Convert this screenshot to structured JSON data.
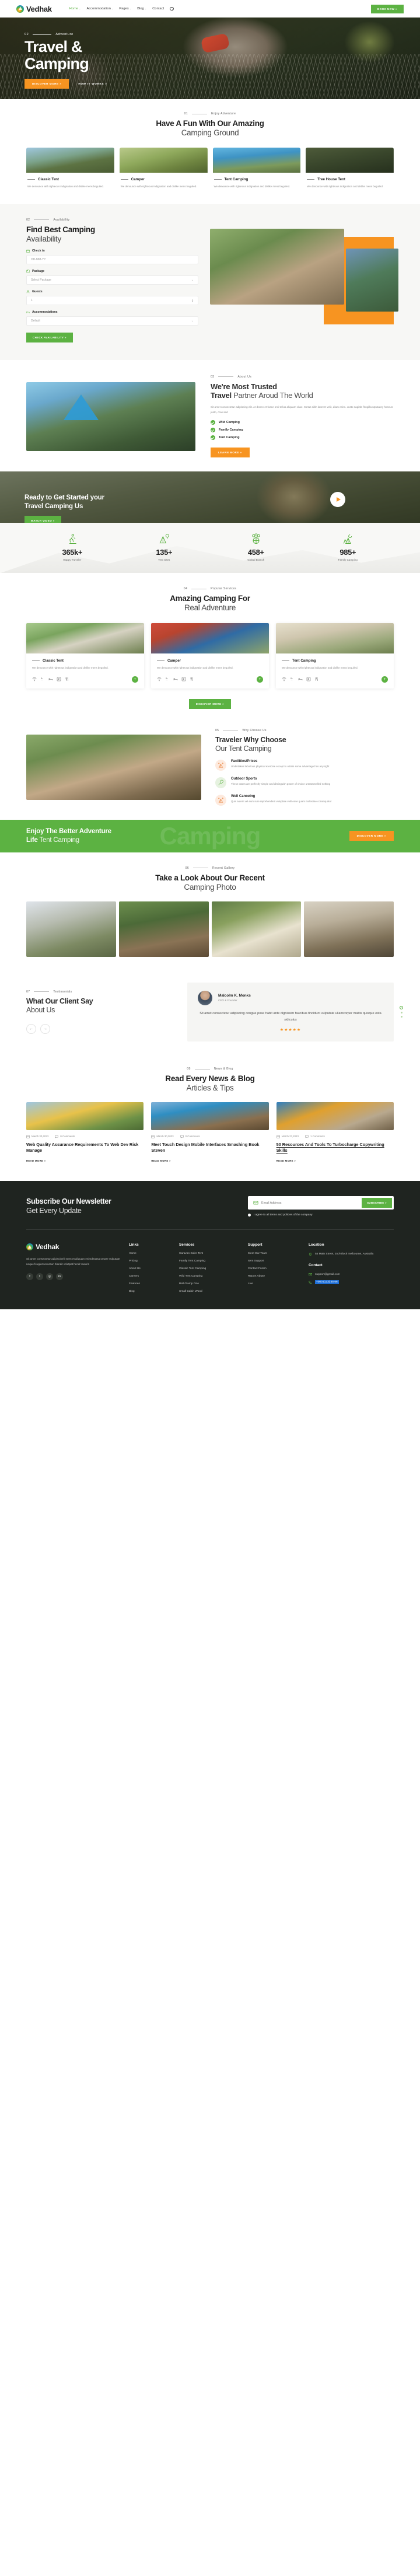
{
  "brand": {
    "name": "Vedhak"
  },
  "header": {
    "nav": [
      {
        "label": "Home",
        "caret": "⌄",
        "active": true
      },
      {
        "label": "Accommodation",
        "caret": "⌄",
        "active": false
      },
      {
        "label": "Pages",
        "caret": "⌄",
        "active": false
      },
      {
        "label": "Blog",
        "caret": "⌄",
        "active": false
      },
      {
        "label": "Contact",
        "caret": "",
        "active": false
      }
    ],
    "search_icon": "search-icon",
    "book_now": "BOOK NOW »"
  },
  "hero": {
    "number": "02",
    "eyebrow": "Adventure",
    "title_line1": "Travel &",
    "title_line2": "Camping",
    "primary_btn": "DISCOVER MORE »",
    "secondary_btn": "HOW IT WORKS »"
  },
  "ground": {
    "number": "01",
    "eyebrow": "Enjoy Adventure",
    "title": "Have A Fun With Our Amazing",
    "subtitle": "Camping Ground",
    "cards": [
      {
        "title": "Classic Tent",
        "text": "We denounce with righteous indignation and dislike mens beguiled."
      },
      {
        "title": "Camper",
        "text": "We denounce with righteous indignation and dislike mens beguiled."
      },
      {
        "title": "Tent Camping",
        "text": "We denounce with righteous indignation and dislike mens beguiled."
      },
      {
        "title": "Tree House Tent",
        "text": "We denounce with righteous indignation and dislike mens beguiled."
      }
    ]
  },
  "availability": {
    "number": "02",
    "eyebrow": "Availability",
    "title": "Find Best Camping",
    "subtitle": "Availability",
    "fields": [
      {
        "label": "Check in",
        "icon": "calendar-icon",
        "value": "DD-MM-YY",
        "type": "text"
      },
      {
        "label": "Package",
        "icon": "package-icon",
        "value": "Select Package",
        "type": "select"
      },
      {
        "label": "Guests",
        "icon": "user-icon",
        "value": "1",
        "type": "number"
      },
      {
        "label": "Accommodations",
        "icon": "bed-icon",
        "value": "Default",
        "type": "select"
      }
    ],
    "submit": "CHECK AVAILABILITY »"
  },
  "about": {
    "number": "03",
    "eyebrow": "About Us",
    "title_bold1": "We're Most Trusted",
    "title_bold2": "Travel",
    "title_thin": " Partner Aroud The World",
    "text": "Sit amet consectetur adipiscing elit. At donec et fusce orci tellus aliquam vitae. Metus nibh laoreet velit, diam enim. Justo sagittis fringilla uIputatey honcus justo, cras sed",
    "ticks": [
      "Wild Camping",
      "Family Camping",
      "Tent Camping"
    ],
    "btn": "LEARN MORE »"
  },
  "cta_video": {
    "title_line1": "Ready to Get Started your",
    "title_line2": "Travel Camping Us",
    "btn": "WATCH VIDEO »",
    "play_icon": "play-icon"
  },
  "stats": [
    {
      "icon": "hiker-icon",
      "num": "365k+",
      "label": "Happy Traveler"
    },
    {
      "icon": "tent-pin-icon",
      "num": "135+",
      "label": "Tent Sites"
    },
    {
      "icon": "globe-icon",
      "num": "458+",
      "label": "Global Branch"
    },
    {
      "icon": "forest-tent-icon",
      "num": "985+",
      "label": "Family Camping"
    }
  ],
  "services": {
    "number": "04",
    "eyebrow": "Popular Services",
    "title": "Amazing Camping For",
    "subtitle": "Real Adventure",
    "cards": [
      {
        "title": "Classic Tent",
        "text": "We denounce with righteous indignation and dislike mens beguiled.",
        "add": "+"
      },
      {
        "title": "Camper",
        "text": "We denounce with righteous indignation and dislike mens beguiled.",
        "add": "+"
      },
      {
        "title": "Tent Camping",
        "text": "We denounce with righteous indignation and dislike mens beguiled.",
        "add": "+"
      }
    ],
    "amenities": [
      "wifi-icon",
      "shower-icon",
      "bed-icon",
      "parking-icon",
      "food-icon"
    ],
    "discover": "DISCOVER MORE »"
  },
  "why": {
    "number": "05",
    "eyebrow": "Why Choose Us",
    "title": "Traveler Why Choose",
    "subtitle": "Our Tent Camping",
    "features": [
      {
        "icon": "tent-price-icon",
        "tone": "orange",
        "title": "Facilities/Prices",
        "text": "Undertakes laborious physical exercise except to obtain some advantage has any right"
      },
      {
        "icon": "sports-icon",
        "tone": "green",
        "title": "Outdoor Sports",
        "text": "These cases are perfectly simple and distinguish power of choice untrammelled nothing"
      },
      {
        "icon": "canoe-icon",
        "tone": "orange",
        "title": "Well Canoeing",
        "text": "Quis autem vel eum sure reprehenderit voluptate velit esse quam molestiae consequatur"
      }
    ]
  },
  "band": {
    "title_bold1": "Enjoy The Better Adventure",
    "title_bold2": "Life",
    "title_thin": " Tent Camping",
    "btn": "DISCOVER MORE »",
    "ghost": "Camping"
  },
  "gallery": {
    "number": "06",
    "eyebrow": "Recent Gallery",
    "title": "Take a Look About Our Recent",
    "subtitle": "Camping Photo"
  },
  "testimonial": {
    "number": "07",
    "eyebrow": "Testimonials",
    "title": "What Our Client Say",
    "subtitle": "About Us",
    "prev": "←",
    "next": "→",
    "name": "Malcolm K. Monks",
    "role": "CEO & Founder",
    "quote": "Sit amet consectetur adipiscing congue pose habit ante dignissim faucibus tincidunt vulputate ullamcorper mattis quisque esta sidiculus",
    "stars": "★★★★★"
  },
  "blog": {
    "number": "08",
    "eyebrow": "News & Blog",
    "title": "Read Every News & Blog",
    "subtitle": "Articles & Tips",
    "posts": [
      {
        "date": "March 30,2023",
        "comments": "0 Comments",
        "title": "Web Quality Assurance Requirements To Web Dev Risk Manage",
        "more": "READ MORE »",
        "underline": false
      },
      {
        "date": "March 30,2023",
        "comments": "0 Comments",
        "title": "Meet Touch Design Mobile Interfaces Smashing Book Steven",
        "more": "READ MORE »",
        "underline": false
      },
      {
        "date": "March 27,2023",
        "comments": "1 Comments",
        "title": "50 Resources And Tools To Turbocharge Copywriting Skills",
        "more": "READ MORE »",
        "underline": true
      }
    ]
  },
  "footer": {
    "newsletter": {
      "title": "Subscribe Our Newsletter",
      "subtitle": "Get Every Update",
      "placeholder": "Email Address",
      "value": "",
      "btn": "SUBSCRIBE »",
      "agree": "I agree to all terms and policies of the company"
    },
    "desc": "Sit amet consectetur adipiscinelit Sem et aliquam enimdeassa ornare vulputate neque feugiat secursun blandit volutpat hendr mauris",
    "socials": [
      "facebook-icon",
      "twitter-icon",
      "instagram-icon",
      "linkedin-icon"
    ],
    "columns": [
      {
        "heading": "Links",
        "items": [
          "Home",
          "Pricing",
          "About Us",
          "Careers",
          "Features",
          "Blog"
        ]
      },
      {
        "heading": "Services",
        "items": [
          "Caravan Soler Tent",
          "Family Tent Camping",
          "Classic Tent Camping",
          "Wild Tent Camping",
          "Bell Glamp One",
          "Small Cabin Wood"
        ]
      },
      {
        "heading": "Support",
        "items": [
          "Meet Our Team",
          "Item Support",
          "Contact Foram",
          "Report Abuse",
          "Live"
        ]
      }
    ],
    "location_heading": "Location",
    "address": "55 Main Street, 2nd-Block melbourne, Australia",
    "contact_heading": "Contact",
    "email": "support@gmail.com",
    "phone": "+000 (123) 45 66"
  }
}
